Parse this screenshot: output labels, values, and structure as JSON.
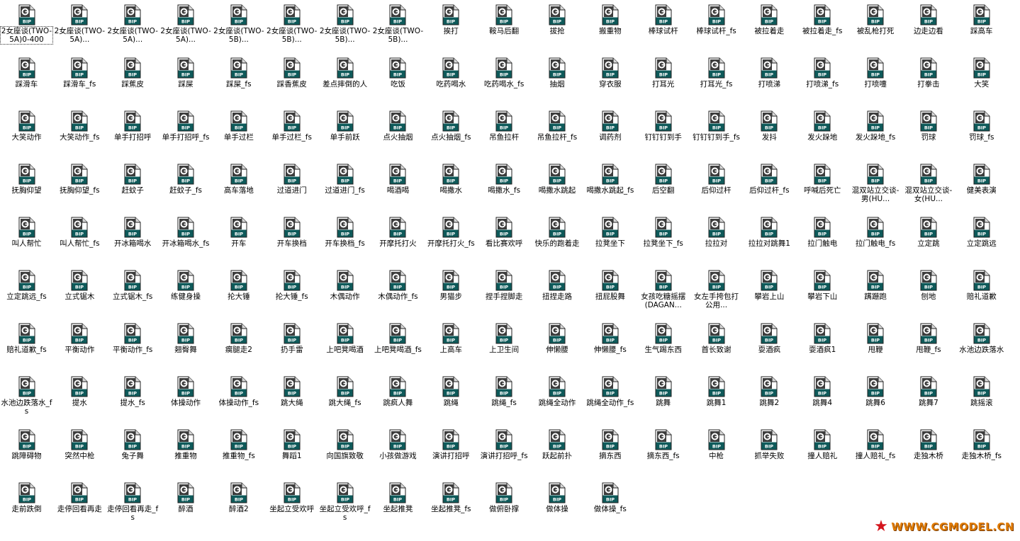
{
  "icon_type": "bip-file-icon",
  "file_badge": "BIP",
  "selected_index": 0,
  "files": [
    "2女座谈(TWO-5A)0-400",
    "2女座谈(TWO-5A)...",
    "2女座谈(TWO-5A)...",
    "2女座谈(TWO-5A)...",
    "2女座谈(TWO-5B)...",
    "2女座谈(TWO-5B)...",
    "2女座谈(TWO-5B)...",
    "2女座谈(TWO-5B)...",
    "挨打",
    "鞍马后翻",
    "拔抢",
    "搬重物",
    "棒球试杆",
    "棒球试杆_fs",
    "被拉着走",
    "被拉着走_fs",
    "被乱枪打死",
    "边走边看",
    "踩高车",
    "踩滑车",
    "踩滑车_fs",
    "踩蕉皮",
    "踩屎",
    "踩屎_fs",
    "踩香蕉皮",
    "差点摔倒的人",
    "吃饭",
    "吃药喝水",
    "吃药喝水_fs",
    "抽烟",
    "穿衣服",
    "打耳光",
    "打耳光_fs",
    "打喷涕",
    "打喷涕_fs",
    "打喷嚏",
    "打拳击",
    "大笑",
    "大笑动作",
    "大笑动作_fs",
    "单手打招呼",
    "单手打招呼_fs",
    "单手过栏",
    "单手过栏_fs",
    "单手前跃",
    "点火抽烟",
    "点火抽烟_fs",
    "吊鱼拉杆",
    "吊鱼拉杆_fs",
    "调药剂",
    "钉钉钉到手",
    "钉钉钉到手_fs",
    "发抖",
    "发火跺地",
    "发火跺地_fs",
    "罚球",
    "罚球_fs",
    "抚胸仰望",
    "抚胸仰望_fs",
    "赶蚊子",
    "赶蚊子_fs",
    "高车落地",
    "过道进门",
    "过道进门_fs",
    "喝酒喝",
    "喝撒水",
    "喝撒水_fs",
    "喝撒水跳起",
    "喝撒水跳起_fs",
    "后空翻",
    "后仰过杆",
    "后仰过杆_fs",
    "呼喊后死亡",
    "混双站立交谈-男(HU...",
    "混双站立交谈-女(HU...",
    "健美表演",
    "叫人帮忙",
    "叫人帮忙_fs",
    "开冰箱喝水",
    "开冰箱喝水_fs",
    "开车",
    "开车换档",
    "开车换档_fs",
    "开摩托打火",
    "开摩托打火_fs",
    "看比赛欢呼",
    "快乐的跑着走",
    "拉凳坐下",
    "拉凳坐下_fs",
    "拉拉对",
    "拉拉对跳舞1",
    "拉门触电",
    "拉门触电_fs",
    "立定跳",
    "立定跳远",
    "立定跳远_fs",
    "立式锯木",
    "立式锯木_fs",
    "练健身操",
    "抡大锤",
    "抡大锤_fs",
    "木偶动作",
    "木偶动作_fs",
    "男猫步",
    "捏手捏脚走",
    "扭捏走路",
    "扭屁股舞",
    "女孩吃糖摇摆(DAGAN...",
    "女左手挎包打公用...",
    "攀岩上山",
    "攀岩下山",
    "蹒跚跑",
    "刨地",
    "赔礼道歉",
    "赔礼道歉_fs",
    "平衡动作",
    "平衡动作_fs",
    "翘臀舞",
    "瘸腿走2",
    "扔手雷",
    "上吧凳喝酒",
    "上吧凳喝酒_fs",
    "上高车",
    "上卫生间",
    "伸懒腰",
    "伸懒腰_fs",
    "生气踢东西",
    "首长致谢",
    "耍酒疯",
    "耍酒疯1",
    "甩鞭",
    "甩鞭_fs",
    "水池边跌落水",
    "水池边跌落水_fs",
    "提水",
    "提水_fs",
    "体操动作",
    "体操动作_fs",
    "跳大绳",
    "跳大绳_fs",
    "跳疯人舞",
    "跳绳",
    "跳绳_fs",
    "跳绳全动作",
    "跳绳全动作_fs",
    "跳舞",
    "跳舞1",
    "跳舞2",
    "跳舞4",
    "跳舞6",
    "跳舞7",
    "跳摇滚",
    "跳障碍物",
    "突然中枪",
    "兔子舞",
    "推重物",
    "推重物_fs",
    "舞蹈1",
    "向国旗致敬",
    "小孩做游戏",
    "演讲打招呼",
    "演讲打招呼_fs",
    "跃起前扑",
    "摘东西",
    "摘东西_fs",
    "中枪",
    "抓举失败",
    "撞人赔礼",
    "撞人赔礼_fs",
    "走独木桥",
    "走独木桥_fs",
    "走前跌倒",
    "走停回看再走",
    "走停回看再走_fs",
    "醉酒",
    "醉酒2",
    "坐起立受欢呼",
    "坐起立受欢呼_fs",
    "坐起推凳",
    "坐起推凳_fs",
    "做俯卧撑",
    "做体操",
    "做体操_fs"
  ],
  "watermark": {
    "text": "WWW.CGMODEL.CN",
    "star_color": "#d4141c",
    "text_color": "#e07b00"
  }
}
